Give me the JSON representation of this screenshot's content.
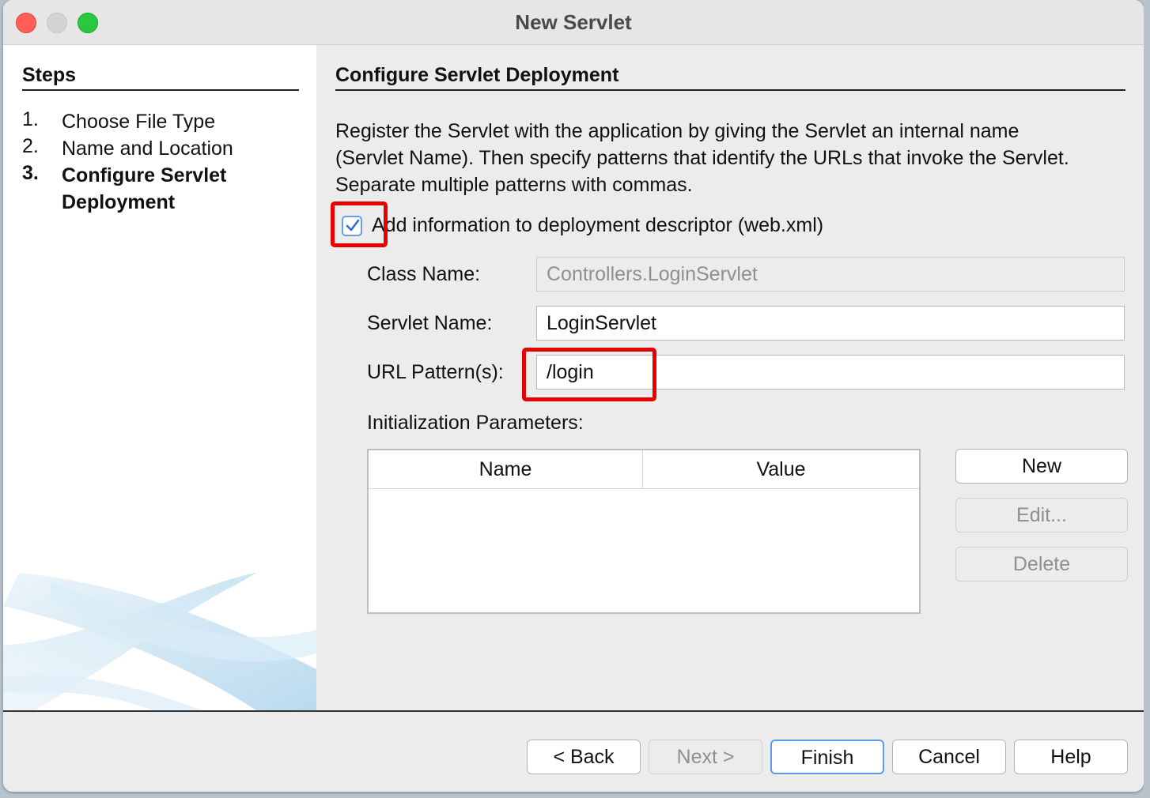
{
  "window": {
    "title": "New Servlet"
  },
  "steps": {
    "title": "Steps",
    "items": [
      {
        "num": "1.",
        "label": "Choose File Type",
        "current": false
      },
      {
        "num": "2.",
        "label": "Name and Location",
        "current": false
      },
      {
        "num": "3.",
        "label_line1": "Configure Servlet",
        "label_line2": "Deployment",
        "current": true
      }
    ]
  },
  "main": {
    "title": "Configure Servlet Deployment",
    "description_lines": [
      "Register the Servlet with the application by giving the Servlet an internal name",
      "(Servlet Name). Then specify patterns that identify the URLs that invoke the Servlet.",
      "Separate multiple patterns with commas."
    ],
    "add_to_descriptor": {
      "label": "Add information to deployment descriptor (web.xml)",
      "checked": true
    },
    "class_name": {
      "label": "Class Name:",
      "value": "Controllers.LoginServlet",
      "enabled": false
    },
    "servlet_name": {
      "label": "Servlet Name:",
      "value": "LoginServlet"
    },
    "url_patterns": {
      "label": "URL Pattern(s):",
      "value": "/login"
    },
    "init_params": {
      "label": "Initialization Parameters:",
      "columns": [
        "Name",
        "Value"
      ],
      "rows": [],
      "buttons": {
        "new": "New",
        "edit": "Edit...",
        "delete": "Delete"
      }
    }
  },
  "footer": {
    "back": "< Back",
    "next": "Next >",
    "finish": "Finish",
    "cancel": "Cancel",
    "help": "Help"
  },
  "colors": {
    "highlight": "#e60000",
    "accent": "#5d9ae8",
    "checkmark": "#2a6fd6"
  }
}
